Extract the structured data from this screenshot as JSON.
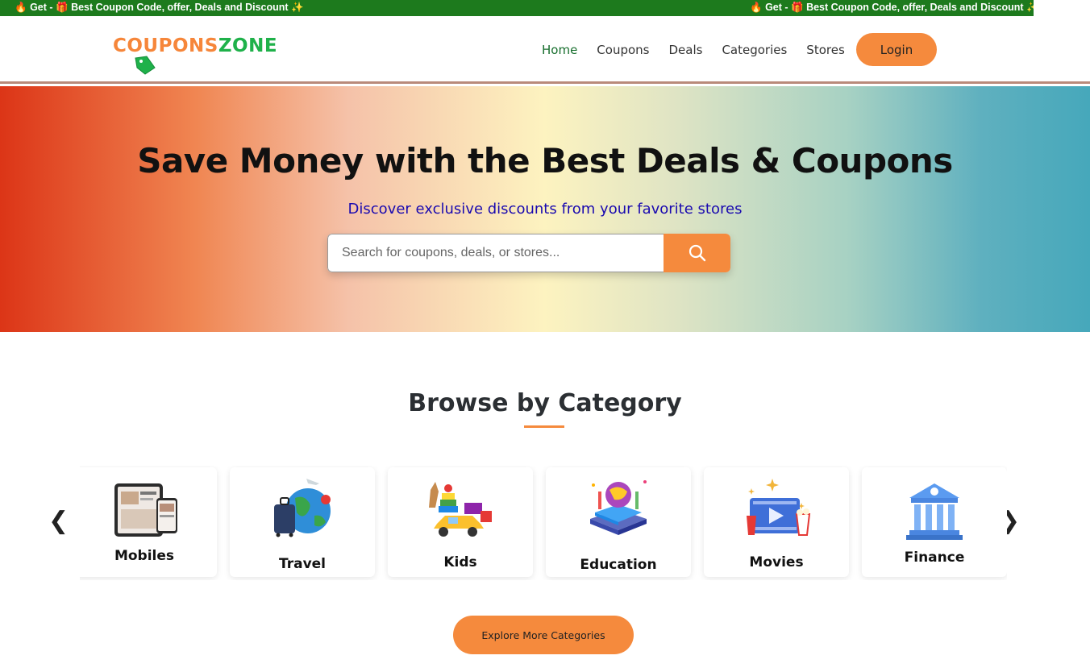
{
  "marquee": {
    "text": "Get - ",
    "text2": "Best Coupon Code, offer, Deals and Discount"
  },
  "header": {
    "logo_part1": "COUPONS",
    "logo_part2": "ZONE",
    "nav": [
      {
        "label": "Home",
        "active": true
      },
      {
        "label": "Coupons"
      },
      {
        "label": "Deals"
      },
      {
        "label": "Categories"
      },
      {
        "label": "Stores"
      }
    ],
    "login_label": "Login"
  },
  "hero": {
    "title": "Save Money with the Best Deals & Coupons",
    "subtitle": "Discover exclusive discounts from your favorite stores",
    "search_placeholder": "Search for coupons, deals, or stores...",
    "search_icon": "search-icon"
  },
  "categories": {
    "title": "Browse by Category",
    "prev_arrow": "❮",
    "next_arrow": "❯",
    "items": [
      {
        "label": "Mobiles",
        "icon": "mobiles-icon"
      },
      {
        "label": "Travel",
        "icon": "travel-icon"
      },
      {
        "label": "Kids",
        "icon": "kids-icon"
      },
      {
        "label": "Education",
        "icon": "education-icon"
      },
      {
        "label": "Movies",
        "icon": "movies-icon"
      },
      {
        "label": "Finance",
        "icon": "finance-icon"
      }
    ],
    "explore_label": "Explore More Categories"
  },
  "colors": {
    "accent": "#f58a3d",
    "brand_green": "#1fb14a",
    "marquee_bg": "#1d7a1d",
    "nav_active": "#176e2d",
    "subtitle": "#1a0ab0"
  }
}
